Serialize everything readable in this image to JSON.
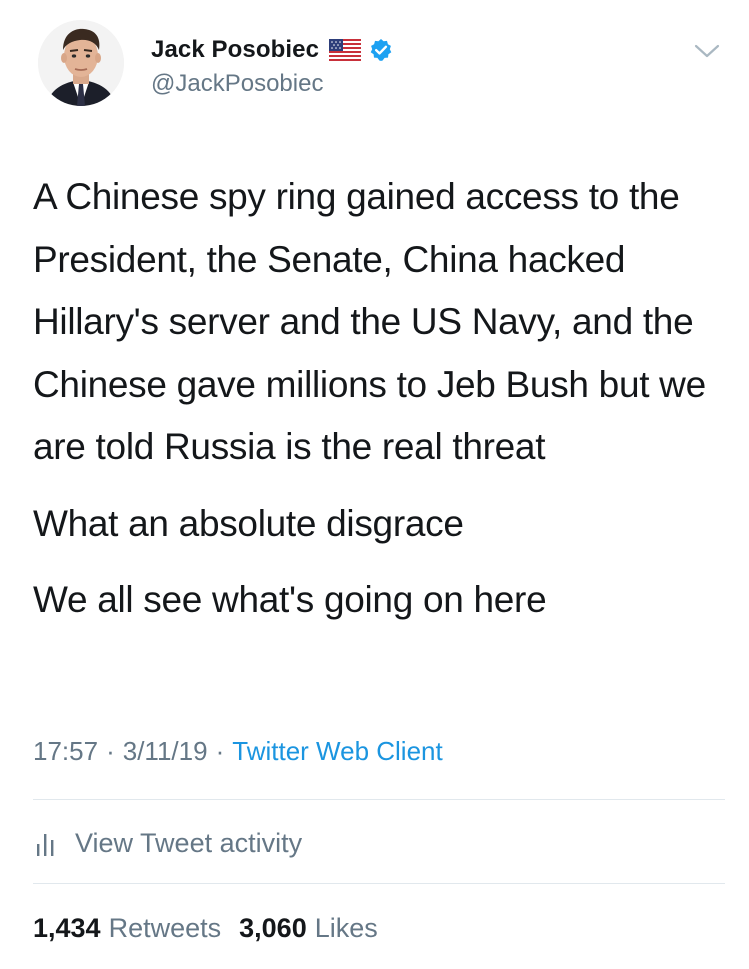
{
  "tweet": {
    "author": {
      "display_name": "Jack Posobiec",
      "handle": "@JackPosobiec",
      "badges": [
        "us-flag-icon",
        "verified-badge-icon"
      ]
    },
    "paragraphs": [
      "A Chinese spy ring gained access to the President, the Senate, China hacked Hillary's server and the US Navy, and the Chinese gave millions to Jeb Bush but we are told Russia is the real threat",
      "What an absolute disgrace",
      "We all see what's going on here"
    ],
    "time": "17:57",
    "date": "3/11/19",
    "separator": "·",
    "source": "Twitter Web Client",
    "activity_label": "View Tweet activity",
    "retweets": {
      "count": "1,434",
      "label": "Retweets"
    },
    "likes": {
      "count": "3,060",
      "label": "Likes"
    }
  },
  "colors": {
    "text_primary": "#14171a",
    "text_secondary": "#657786",
    "link": "#1b95e0",
    "verified": "#1da1f2",
    "divider": "#e1e8ed"
  }
}
